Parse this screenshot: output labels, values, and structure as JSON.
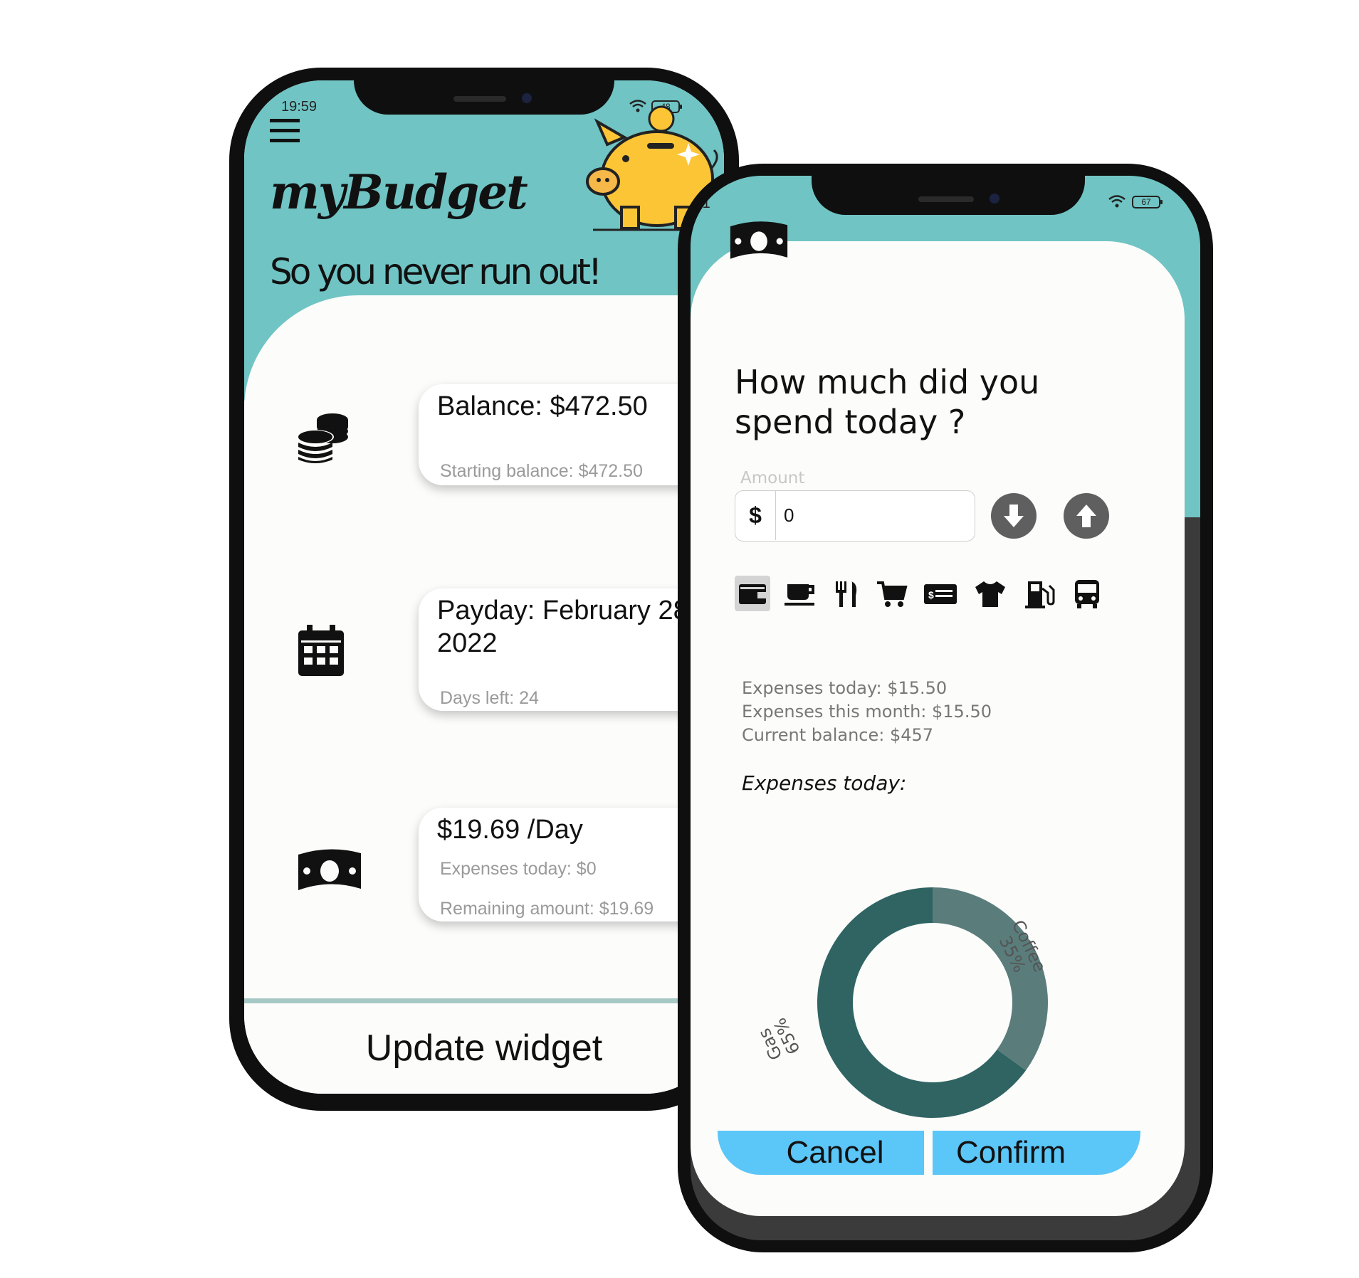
{
  "phone_left": {
    "status_time": "19:59",
    "battery": "48",
    "app_title": "myBudget",
    "tagline": "So you never run out!",
    "cards": [
      {
        "main": "Balance: $472.50",
        "subs": [
          "Starting balance: $472.50"
        ]
      },
      {
        "main": "Payday: February 28, 2022",
        "subs": [
          "Days left: 24"
        ]
      },
      {
        "main": "$19.69 /Day",
        "subs": [
          "Expenses today: $0",
          "Remaining amount: $19.69"
        ]
      }
    ],
    "update_button": "Update widget"
  },
  "phone_right": {
    "status_time": ":01",
    "battery": "67",
    "question": "How much did you spend today ?",
    "amount": {
      "label": "Amount",
      "currency": "$",
      "value": "0"
    },
    "categories": [
      "wallet-icon",
      "coffee-icon",
      "restaurant-icon",
      "cart-icon",
      "bill-icon",
      "shirt-icon",
      "gas-station-icon",
      "bus-icon"
    ],
    "stats": {
      "expenses_today": "Expenses today: $15.50",
      "expenses_month": "Expenses this month: $15.50",
      "current_balance": "Current balance: $457"
    },
    "chart_heading": "Expenses today:",
    "chart_data": {
      "type": "pie",
      "categories": [
        "Coffee",
        "Gas"
      ],
      "values": [
        35,
        65
      ],
      "labels": {
        "coffee_name": "Coffee",
        "coffee_pct": "35%",
        "gas_name": "Gas",
        "gas_pct": "65%"
      },
      "colors": [
        "#5a7d7c",
        "#2f6463"
      ]
    },
    "buttons": {
      "cancel": "Cancel",
      "confirm": "Confirm"
    }
  },
  "colors": {
    "teal": "#70c4c4",
    "button_blue": "#5bc6f8",
    "pig_yellow": "#fcc536"
  }
}
